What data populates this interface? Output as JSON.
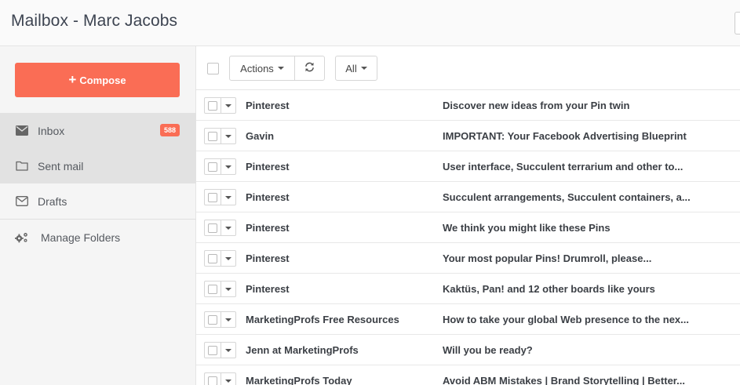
{
  "header": {
    "title": "Mailbox - Marc Jacobs"
  },
  "sidebar": {
    "compose_label": "Compose",
    "items": [
      {
        "label": "Inbox",
        "icon": "envelope-icon",
        "badge": "588"
      },
      {
        "label": "Sent mail",
        "icon": "folder-icon"
      },
      {
        "label": "Drafts",
        "icon": "envelope-outline-icon"
      },
      {
        "label": "Manage Folders",
        "icon": "gears-icon"
      }
    ]
  },
  "toolbar": {
    "actions_label": "Actions",
    "filter_label": "All"
  },
  "emails": [
    {
      "from": "Pinterest",
      "subject": "Discover new ideas from your Pin twin"
    },
    {
      "from": "Gavin",
      "subject": "IMPORTANT: Your Facebook Advertising Blueprint"
    },
    {
      "from": "Pinterest",
      "subject": "User interface, Succulent terrarium and other to..."
    },
    {
      "from": "Pinterest",
      "subject": "Succulent arrangements, Succulent containers, a..."
    },
    {
      "from": "Pinterest",
      "subject": "We think you might like these Pins"
    },
    {
      "from": "Pinterest",
      "subject": "Your most popular Pins! Drumroll, please..."
    },
    {
      "from": "Pinterest",
      "subject": "Kaktüs, Pan! and 12 other boards like yours"
    },
    {
      "from": "MarketingProfs Free Resources",
      "subject": "How to take your global Web presence to the nex..."
    },
    {
      "from": "Jenn at MarketingProfs",
      "subject": "Will you be ready?"
    },
    {
      "from": "MarketingProfs Today",
      "subject": "Avoid ABM Mistakes | Brand Storytelling | Better..."
    }
  ],
  "colors": {
    "accent": "#fa6d55",
    "sidebar_bg": "#f5f5f5",
    "active_bg": "#e2e2e2"
  }
}
